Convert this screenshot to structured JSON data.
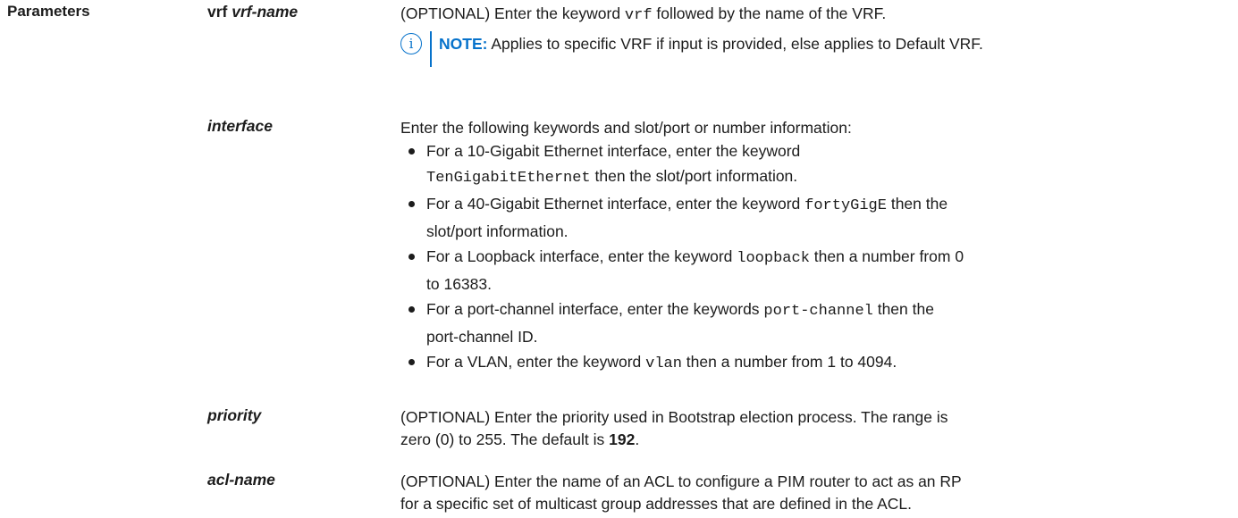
{
  "section_label": "Parameters",
  "params": {
    "vrf": {
      "term_keyword": "vrf",
      "term_arg": "vrf-name",
      "desc_pre": "(OPTIONAL) Enter the keyword ",
      "desc_code": "vrf",
      "desc_post": " followed by the name of the VRF.",
      "note_icon": "info-icon",
      "note_label": "NOTE:",
      "note_text": " Applies to specific VRF if input is provided, else applies to Default VRF."
    },
    "interface": {
      "term": "interface",
      "intro": "Enter the following keywords and slot/port or number information:",
      "bullets": [
        {
          "l1_pre": "For a 10-Gigabit Ethernet interface, enter the keyword",
          "l2_code": "TenGigabitEthernet",
          "l2_post": " then the slot/port information."
        },
        {
          "l1_pre": "For a 40-Gigabit Ethernet interface, enter the keyword ",
          "l1_code": "fortyGigE",
          "l1_post": " then the",
          "l2_post": "slot/port information."
        },
        {
          "l1_pre": "For a Loopback interface, enter the keyword ",
          "l1_code": "loopback",
          "l1_post": " then a number from 0",
          "l2_post": "to 16383."
        },
        {
          "l1_pre": "For a port-channel interface, enter the keywords ",
          "l1_code": "port-channel",
          "l1_post": " then the",
          "l2_post": "port-channel ID."
        },
        {
          "l1_pre": "For a VLAN, enter the keyword ",
          "l1_code": "vlan",
          "l1_post": " then a number from 1 to 4094."
        }
      ]
    },
    "priority": {
      "term": "priority",
      "line1": "(OPTIONAL) Enter the priority used in Bootstrap election process. The range is",
      "line2_pre": "zero (0) to 255. The default is ",
      "line2_bold": "192",
      "line2_post": "."
    },
    "acl": {
      "term": "acl-name",
      "line1": "(OPTIONAL) Enter the name of an ACL to configure a PIM router to act as an RP",
      "line2": "for a specific set of multicast group addresses that are defined in the ACL."
    }
  },
  "colors": {
    "accent": "#0672cb",
    "text": "#1c1c1c"
  }
}
